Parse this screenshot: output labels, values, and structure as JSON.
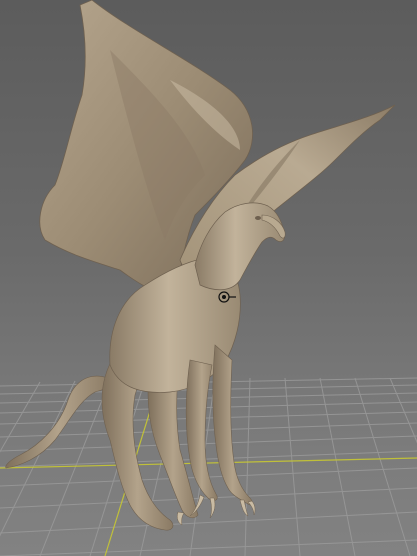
{
  "viewport": {
    "background_top": "#5c5c5c",
    "background_bottom": "#828282",
    "grid_color": "#9a9a9a",
    "grid_axis_x_color": "#c8c832",
    "grid_axis_z_color": "#c8c832",
    "model_color": "#a89880",
    "model_shadow": "#7d6e5c",
    "model_highlight": "#c9baa3",
    "pivot_icon": "pivot-target-icon"
  }
}
